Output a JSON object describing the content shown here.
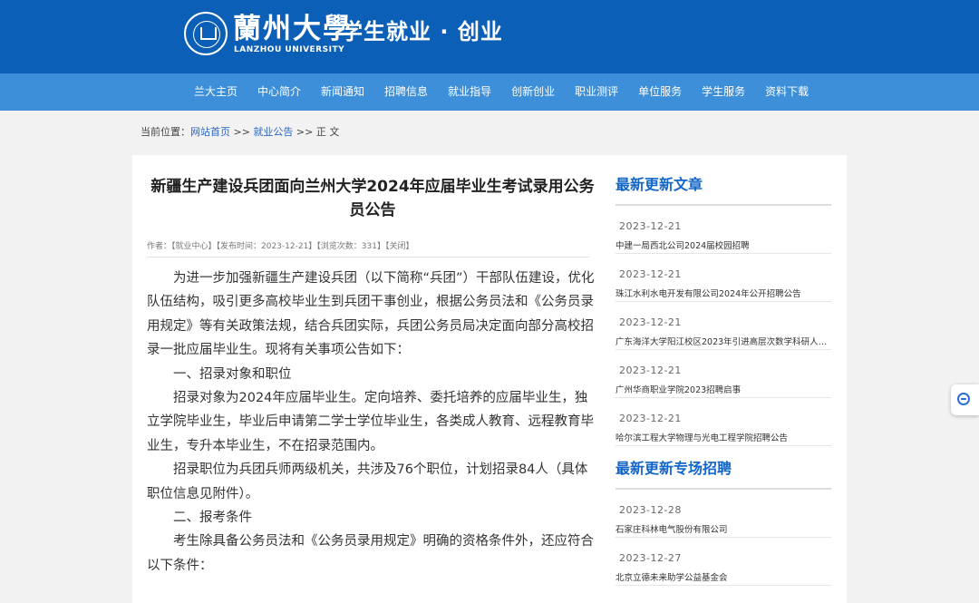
{
  "header": {
    "university_cn": "蘭州大學",
    "university_en": "LANZHOU UNIVERSITY",
    "site_title": "学生就业 · 创业"
  },
  "nav": {
    "items": [
      "兰大主页",
      "中心简介",
      "新闻通知",
      "招聘信息",
      "就业指导",
      "创新创业",
      "职业测评",
      "单位服务",
      "学生服务",
      "资料下载"
    ]
  },
  "breadcrumb": {
    "prefix": "当前位置：",
    "home": "网站首页",
    "sep1": " >> ",
    "category": "就业公告",
    "sep2": " >> ",
    "current": "正 文"
  },
  "article": {
    "title": "新疆生产建设兵团面向兰州大学2024年应届毕业生考试录用公务员公告",
    "meta": "作者：【就业中心】【发布时间：2023-12-21】【浏览次数：331】【关闭】",
    "paragraphs": [
      "为进一步加强新疆生产建设兵团（以下简称“兵团”）干部队伍建设，优化队伍结构，吸引更多高校毕业生到兵团干事创业，根据公务员法和《公务员录用规定》等有关政策法规，结合兵团实际，兵团公务员局决定面向部分高校招录一批应届毕业生。现将有关事项公告如下：",
      "一、招录对象和职位",
      "招录对象为2024年应届毕业生。定向培养、委托培养的应届毕业生，独立学院毕业生，毕业后申请第二学士学位毕业生，各类成人教育、远程教育毕业生，专升本毕业生，不在招录范围内。",
      "招录职位为兵团兵师两级机关，共涉及76个职位，计划招录84人（具体职位信息见附件）。",
      "二、报考条件",
      "考生除具备公务员法和《公务员录用规定》明确的资格条件外，还应符合以下条件："
    ]
  },
  "sidebar": {
    "latest_title": "最新更新文章",
    "latest": [
      {
        "date": "2023-12-21",
        "title": "中建一局西北公司2024届校园招聘"
      },
      {
        "date": "2023-12-21",
        "title": "珠江水利水电开发有限公司2024年公开招聘公告"
      },
      {
        "date": "2023-12-21",
        "title": "广东海洋大学阳江校区2023年引进高层次数学科研人员..."
      },
      {
        "date": "2023-12-21",
        "title": "广州华商职业学院2023招聘启事"
      },
      {
        "date": "2023-12-21",
        "title": "哈尔滨工程大学物理与光电工程学院招聘公告"
      }
    ],
    "special_title": "最新更新专场招聘",
    "special": [
      {
        "date": "2023-12-28",
        "title": "石家庄科林电气股份有限公司"
      },
      {
        "date": "2023-12-27",
        "title": "北京立德未来助学公益基金会"
      }
    ]
  }
}
